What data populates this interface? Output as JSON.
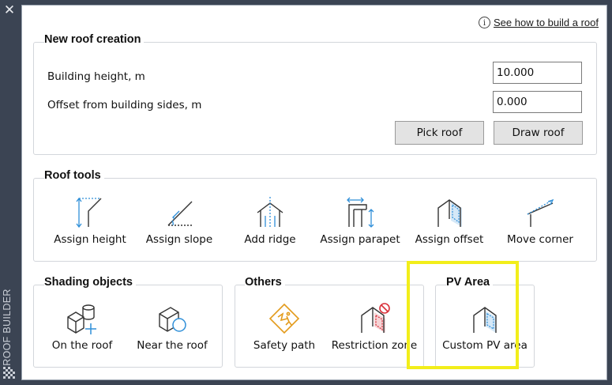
{
  "sidebar": {
    "close_label": "✕",
    "vertical_title": "ROOF BUILDER"
  },
  "help": {
    "info_glyph": "i",
    "link_text": "See how to build a roof"
  },
  "new_roof": {
    "title": "New roof creation",
    "height_label": "Building height, m",
    "height_value": "10.000",
    "offset_label": "Offset from building sides, m",
    "offset_value": "0.000",
    "pick_label": "Pick roof",
    "draw_label": "Draw roof"
  },
  "roof_tools": {
    "title": "Roof tools",
    "items": [
      {
        "label": "Assign height",
        "icon": "assign-height-icon"
      },
      {
        "label": "Assign slope",
        "icon": "assign-slope-icon"
      },
      {
        "label": "Add ridge",
        "icon": "add-ridge-icon"
      },
      {
        "label": "Assign parapet",
        "icon": "assign-parapet-icon"
      },
      {
        "label": "Assign offset",
        "icon": "assign-offset-icon"
      },
      {
        "label": "Move corner",
        "icon": "move-corner-icon"
      }
    ]
  },
  "shading": {
    "title": "Shading objects",
    "items": [
      {
        "label": "On the roof",
        "icon": "on-roof-object-icon"
      },
      {
        "label": "Near the roof",
        "icon": "near-roof-object-icon"
      }
    ]
  },
  "others": {
    "title": "Others",
    "items": [
      {
        "label": "Safety path",
        "icon": "safety-path-icon"
      },
      {
        "label": "Restriction zone",
        "icon": "restriction-zone-icon"
      }
    ]
  },
  "pv_area": {
    "title": "PV Area",
    "items": [
      {
        "label": "Custom PV area",
        "icon": "custom-pv-area-icon"
      }
    ]
  },
  "colors": {
    "accent_blue": "#2f8fd8",
    "highlight_yellow": "#f2ee1a",
    "warning_orange": "#e39b1c",
    "restriction_red": "#d9303a",
    "sidebar_bg": "#3b4453"
  }
}
